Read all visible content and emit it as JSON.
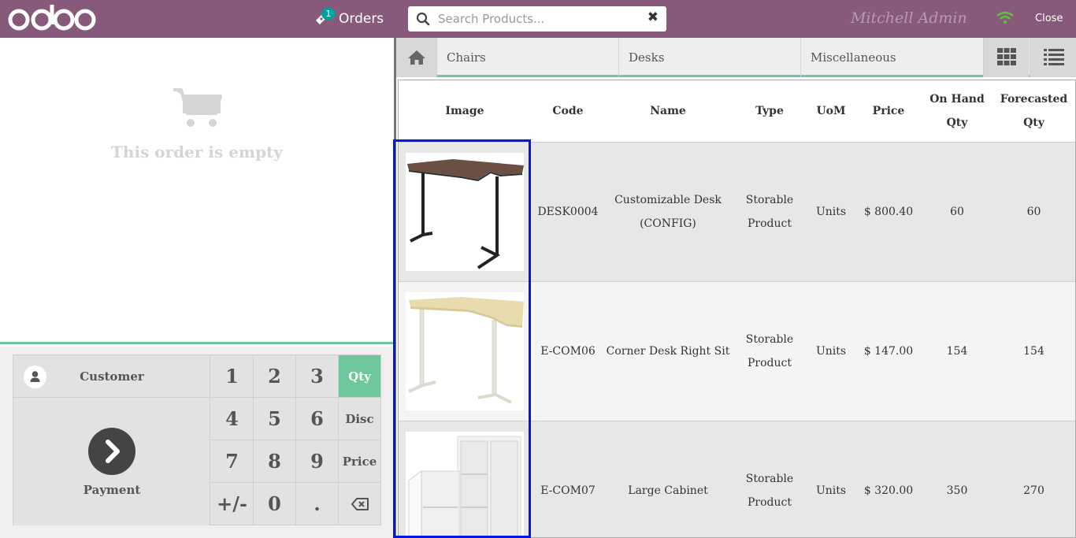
{
  "header": {
    "orders_label": "Orders",
    "orders_count": "1",
    "search": {
      "placeholder": "Search Products...",
      "value": ""
    },
    "user_name": "Mitchell Admin",
    "close_label": "Close"
  },
  "order": {
    "empty_message": "This order is empty"
  },
  "pad": {
    "customer_label": "Customer",
    "payment_label": "Payment",
    "keys": [
      "1",
      "2",
      "3",
      "4",
      "5",
      "6",
      "7",
      "8",
      "9",
      "+/-",
      "0",
      "."
    ],
    "modes": [
      "Qty",
      "Disc",
      "Price"
    ],
    "active_mode": "Qty"
  },
  "categories": [
    "Chairs",
    "Desks",
    "Miscellaneous"
  ],
  "table": {
    "headers": [
      "Image",
      "Code",
      "Name",
      "Type",
      "UoM",
      "Price",
      "On Hand Qty",
      "Forecasted Qty"
    ],
    "rows": [
      {
        "code": "DESK0004",
        "name": "Customizable Desk (CONFIG)",
        "type": "Storable Product",
        "uom": "Units",
        "price": "$ 800.40",
        "on_hand": "60",
        "forecasted": "60"
      },
      {
        "code": "E-COM06",
        "name": "Corner Desk Right Sit",
        "type": "Storable Product",
        "uom": "Units",
        "price": "$ 147.00",
        "on_hand": "154",
        "forecasted": "154"
      },
      {
        "code": "E-COM07",
        "name": "Large Cabinet",
        "type": "Storable Product",
        "uom": "Units",
        "price": "$ 320.00",
        "on_hand": "350",
        "forecasted": "270"
      }
    ]
  },
  "colors": {
    "brand": "#875a7b",
    "accent": "#6ec89b",
    "highlight": "#0018e6"
  }
}
